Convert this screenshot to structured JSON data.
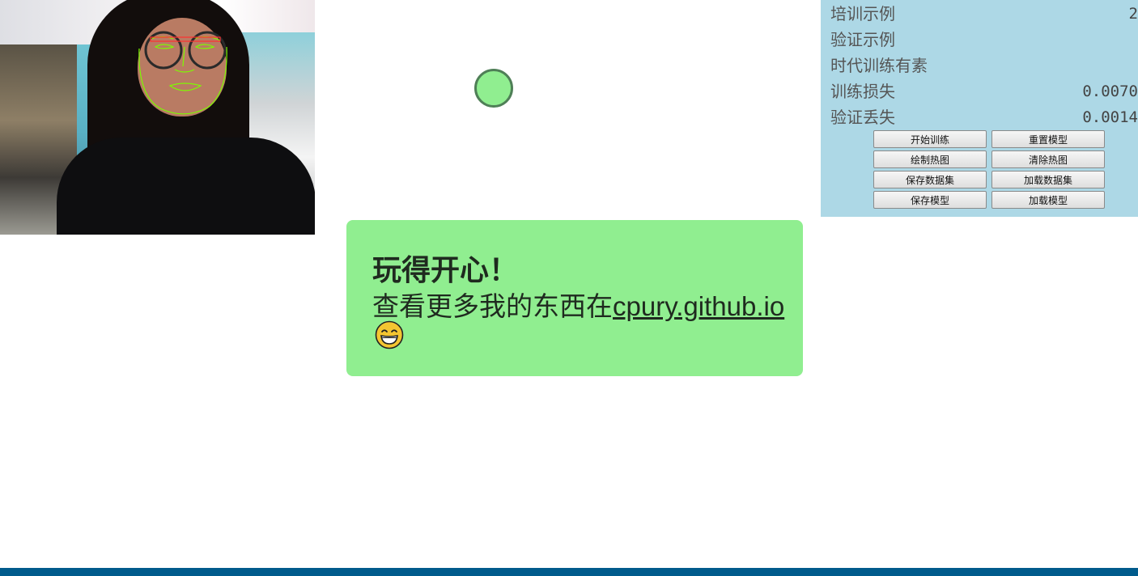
{
  "stats": [
    {
      "label": "培训示例",
      "value": "2"
    },
    {
      "label": "验证示例",
      "value": ""
    },
    {
      "label": "时代训练有素",
      "value": ""
    },
    {
      "label": "训练损失",
      "value": "0.0070"
    },
    {
      "label": "验证丢失",
      "value": "0.0014"
    }
  ],
  "buttons": {
    "start_training": "开始训练",
    "reset_model": "重置模型",
    "draw_heatmap": "绘制热图",
    "clear_heatmap": "清除热图",
    "save_dataset": "保存数据集",
    "load_dataset": "加载数据集",
    "save_model": "保存模型",
    "load_model": "加载模型"
  },
  "card": {
    "title": "玩得开心！",
    "text": "查看更多我的东西在",
    "link": "cpury.github.io"
  },
  "colors": {
    "panel_bg": "#add8e6",
    "card_bg": "#90ee90",
    "dot_fill": "#90ee90",
    "dot_border": "#4f7f57",
    "bottom_bar": "#005b8c"
  },
  "icons": {
    "emoji": "grinning-face-icon"
  }
}
